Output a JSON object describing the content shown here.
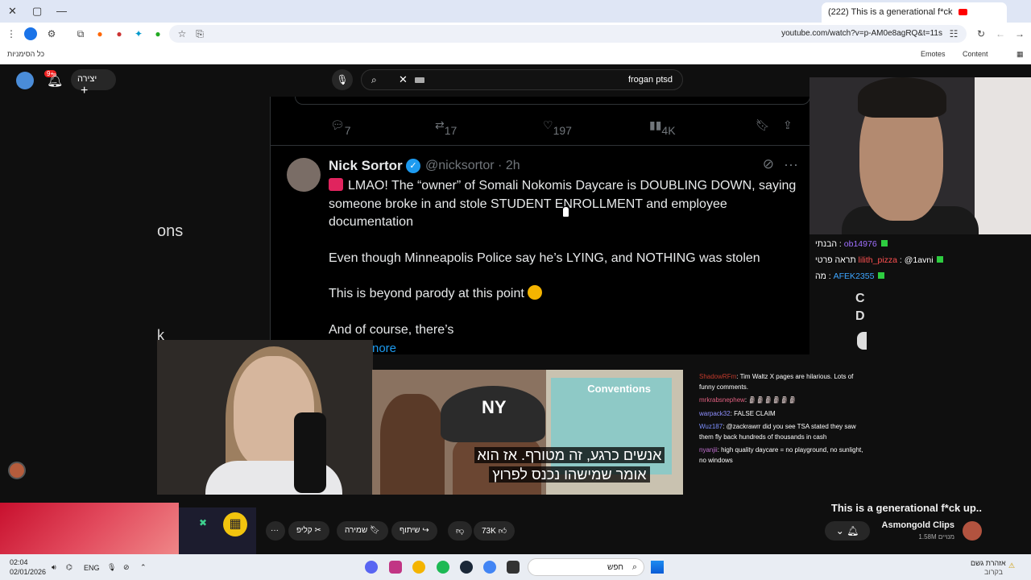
{
  "browser": {
    "tab_title": "(222) This is a generational f*ck",
    "url": "youtube.com/watch?v=p-AM0e8agRQ&t=11s",
    "bookmarks_label": "כל הסימניות",
    "bookmark_emotes": "Emotes",
    "bookmark_content": "Content"
  },
  "youtube": {
    "search_query": "frogan ptsd",
    "create_label": "יצירה",
    "notif_count": "9+"
  },
  "tweet_prev_actions": {
    "replies": "7",
    "retweets": "17",
    "likes": "197",
    "views": "4K"
  },
  "tweet": {
    "name": "Nick Sortor",
    "handle": "@nicksortor · 2h",
    "line1": "LMAO! The “owner” of Somali Nokomis Daycare is DOUBLING DOWN, saying someone broke in and stole STUDENT ENROLLMENT and employee documentation",
    "line2": "Even though Minneapolis Police say he’s LYING, and NOTHING was stolen",
    "line3": "This is beyond parody at this point",
    "line4": "And of course, there’s",
    "more": "nore"
  },
  "ghost_text": {
    "a": "ons",
    "b": "k"
  },
  "clip": {
    "sign_text": "Conventions",
    "cap_logo": "NY",
    "subtitle_line1": "אנשים כרגע, זה מטורף.  אז הוא",
    "subtitle_line2": "אומר שמישהו נכנס לפרוץ"
  },
  "chat_top": [
    {
      "user": "ob14976",
      "msg": "הבנתי"
    },
    {
      "user": "lilith_pizza",
      "msg": "@1avni תראה פרטי"
    },
    {
      "user": "AFEK2355",
      "msg": "מה"
    }
  ],
  "chat_top_side": "C\nD",
  "chat_bottom": [
    {
      "user": "ShadowRFm",
      "msg": "Tim Waltz X pages are hilarious. Lots of funny comments."
    },
    {
      "user": "mrkrabsnephew",
      "msg": "🗿🗿🗿🗿🗿🗿"
    },
    {
      "user": "warpack32",
      "msg": "FALSE CLAIM"
    },
    {
      "user": "Wuz187",
      "msg": "@zackrawrr did you see TSA stated they saw them fly back hundreds of thousands in cash"
    },
    {
      "user": "nyanjii",
      "msg": "high quality daycare = no playground, no sunlight, no windows"
    }
  ],
  "video": {
    "title": "This is a generational f*ck up..",
    "channel": "Asmongold Clips",
    "subscribers": "1.58M מנויים",
    "likes": "73K",
    "share": "שיתוף",
    "save": "שמירה",
    "clip": "קליפ"
  },
  "taskbar": {
    "time": "02:04",
    "date": "02/01/2026",
    "lang": "ENG",
    "search_label": "חפש",
    "weather_line1": "אזהרת גשם",
    "weather_line2": "בקרוב"
  },
  "colors": {
    "twitter_blue": "#1d9bf0",
    "youtube_red": "#ff0000"
  }
}
